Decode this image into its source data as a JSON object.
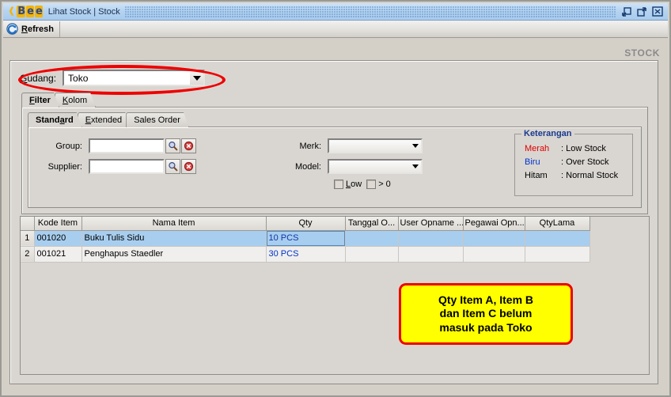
{
  "window": {
    "logo_text": "Bee",
    "title": "Lihat Stock | Stock",
    "buttons": [
      {
        "name": "restore-down",
        "label": "Restore Down"
      },
      {
        "name": "maximize",
        "label": "Maximize"
      },
      {
        "name": "close",
        "label": "Close"
      }
    ]
  },
  "toolbar": {
    "refresh_label": "Refresh",
    "refresh_mnemonic": "R",
    "refresh_rest": "efresh",
    "refresh_icon": "refresh-icon"
  },
  "page": {
    "stock_label": "STOCK"
  },
  "gudang": {
    "label_mnemonic": "G",
    "label_rest": "udang:",
    "value": "Toko"
  },
  "tabs": {
    "main": [
      {
        "mnemonic": "F",
        "rest": "ilter",
        "label": "Filter",
        "selected": true
      },
      {
        "mnemonic": "K",
        "rest": "olom",
        "label": "Kolom",
        "selected": false
      }
    ],
    "sub": [
      {
        "pre": "Stand",
        "mnemonic": "a",
        "post": "rd",
        "label": "Standard",
        "selected": true
      },
      {
        "pre": "",
        "mnemonic": "E",
        "post": "xtended",
        "label": "Extended",
        "selected": false
      },
      {
        "pre": "Sales Order",
        "mnemonic": "",
        "post": "",
        "label": "Sales Order",
        "selected": false
      }
    ]
  },
  "filter": {
    "group_label": "Group:",
    "group_value": "",
    "supplier_label": "Supplier:",
    "supplier_value": "",
    "merk_label": "Merk:",
    "merk_value": "",
    "model_label": "Model:",
    "model_value": "",
    "low_mnemonic": "L",
    "low_rest": "ow",
    "low_label": "Low",
    "gtzero_label": "> 0",
    "search_icon": "magnifier-icon",
    "clear_icon": "clear-circle-icon"
  },
  "legend": {
    "title": "Keterangan",
    "rows": [
      {
        "key": "Merah",
        "sep": ": ",
        "value": "Low Stock",
        "color": "red"
      },
      {
        "key": "Biru",
        "sep": ": ",
        "value": "Over Stock",
        "color": "blue"
      },
      {
        "key": "Hitam",
        "sep": ": ",
        "value": "Normal Stock",
        "color": "black"
      }
    ]
  },
  "table": {
    "columns": [
      "",
      "Kode Item",
      "Nama Item",
      "Qty",
      "Tanggal O...",
      "User Opname ...",
      "Pegawai Opn...",
      "QtyLama"
    ],
    "rows": [
      {
        "num": "1",
        "kode": "001020",
        "nama": "Buku Tulis Sidu",
        "qty": "10 PCS",
        "tanggal": "",
        "user_opname": "",
        "pegawai_opname": "",
        "qty_lama": "",
        "selected": true
      },
      {
        "num": "2",
        "kode": "001021",
        "nama": "Penghapus Staedler",
        "qty": "30 PCS",
        "tanggal": "",
        "user_opname": "",
        "pegawai_opname": "",
        "qty_lama": "",
        "selected": false
      }
    ]
  },
  "annotations": {
    "ellipse_color": "#ee0000",
    "callout_line1": "Qty Item A, Item B",
    "callout_line2": "dan Item C belum",
    "callout_line3": "masuk pada Toko",
    "callout_bg": "#ffff00",
    "callout_border": "#ee0000"
  }
}
